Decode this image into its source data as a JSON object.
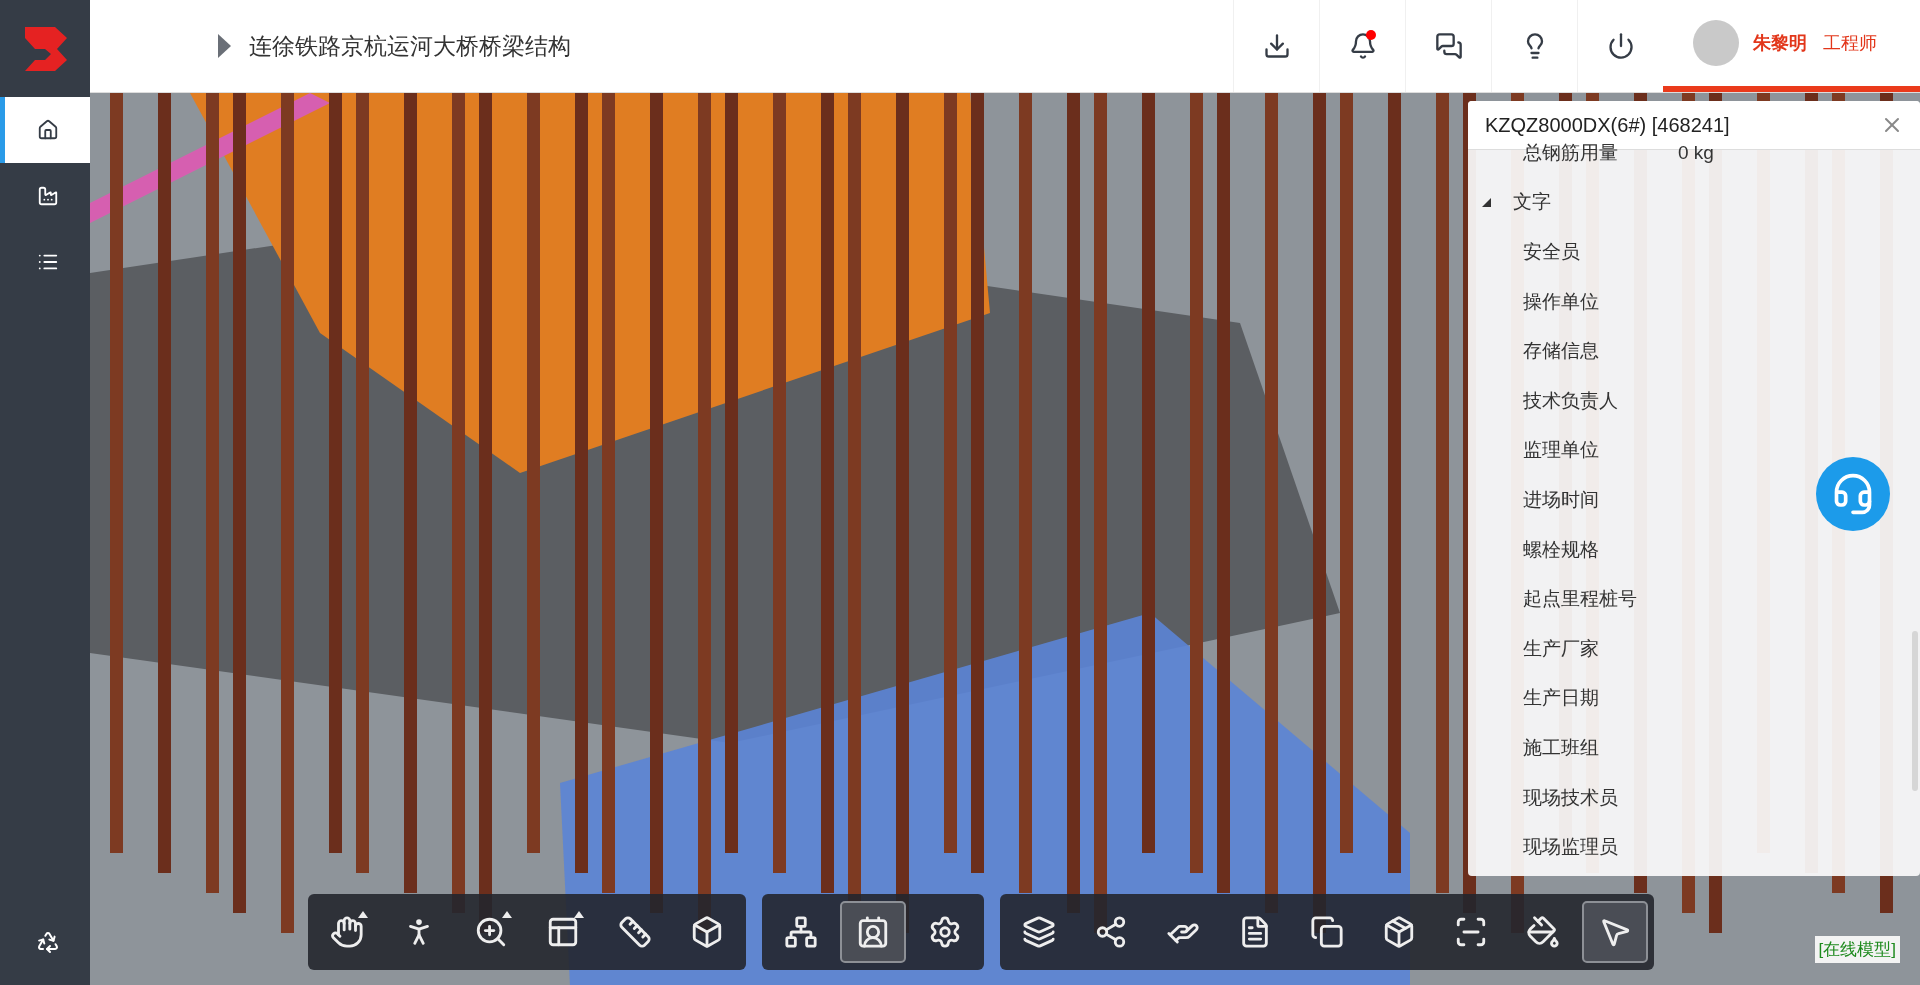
{
  "header": {
    "title": "连徐铁路京杭运河大桥桥梁结构",
    "actions": [
      {
        "badge": false
      },
      {
        "badge": true
      },
      {
        "badge": false
      },
      {
        "badge": false
      },
      {
        "badge": false
      }
    ],
    "user": {
      "name": "朱黎明",
      "role": "工程师"
    }
  },
  "sidebar": {
    "items": [
      {
        "selected": true
      },
      {
        "selected": false
      },
      {
        "selected": false
      }
    ]
  },
  "properties_panel": {
    "title": "KZQZ8000DX(6#) [468241]",
    "top_row": {
      "label": "总钢筋用量",
      "value": "0 kg"
    },
    "groups": [
      {
        "name": "文字",
        "expanded": true,
        "children": [
          "安全员",
          "操作单位",
          "存储信息",
          "技术负责人",
          "监理单位",
          "进场时间",
          "螺栓规格",
          "起点里程桩号",
          "生产厂家",
          "生产日期",
          "施工班组",
          "现场技术员",
          "现场监理员"
        ]
      }
    ]
  },
  "toolbar": {
    "groups": [
      {
        "tools": [
          {
            "selected": false,
            "has_menu": true
          },
          {
            "selected": false,
            "has_menu": false
          },
          {
            "selected": false,
            "has_menu": true
          },
          {
            "selected": false,
            "has_menu": true
          },
          {
            "selected": false,
            "has_menu": false
          },
          {
            "selected": false,
            "has_menu": false
          }
        ]
      },
      {
        "tools": [
          {
            "selected": false,
            "has_menu": false
          },
          {
            "selected": true,
            "has_menu": false
          },
          {
            "selected": false,
            "has_menu": false
          }
        ]
      },
      {
        "tools": [
          {
            "selected": false,
            "has_menu": false
          },
          {
            "selected": false,
            "has_menu": false
          },
          {
            "selected": false,
            "has_menu": false
          },
          {
            "selected": false,
            "has_menu": false
          },
          {
            "selected": false,
            "has_menu": false
          },
          {
            "selected": false,
            "has_menu": false
          },
          {
            "selected": false,
            "has_menu": false
          },
          {
            "selected": false,
            "has_menu": false
          },
          {
            "selected": true,
            "has_menu": false
          }
        ]
      }
    ]
  },
  "status": "[在线模型]"
}
